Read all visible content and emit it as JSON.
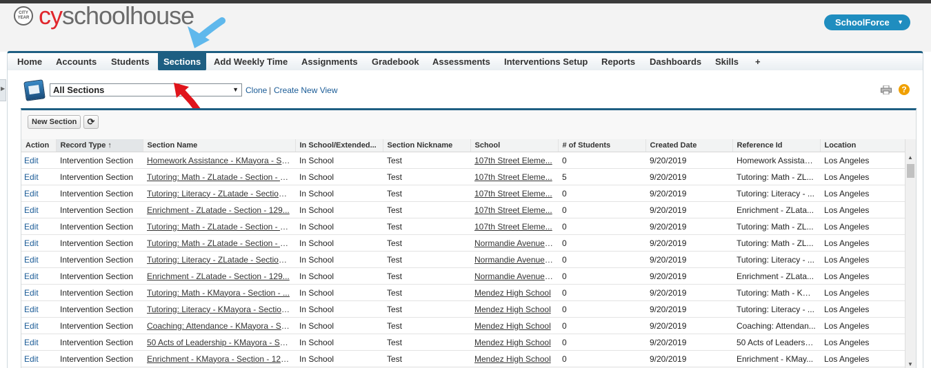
{
  "header": {
    "logo_seal": "CITY YEAR",
    "logo_prefix": "cy",
    "logo_rest": "schoolhouse",
    "app_menu_label": "SchoolForce",
    "app_menu_caret": "▼"
  },
  "tabs": [
    {
      "label": "Home"
    },
    {
      "label": "Accounts"
    },
    {
      "label": "Students"
    },
    {
      "label": "Sections",
      "active": true
    },
    {
      "label": "Add Weekly Time"
    },
    {
      "label": "Assignments"
    },
    {
      "label": "Gradebook"
    },
    {
      "label": "Assessments"
    },
    {
      "label": "Interventions Setup"
    },
    {
      "label": "Reports"
    },
    {
      "label": "Dashboards"
    },
    {
      "label": "Skills"
    },
    {
      "label": "+"
    }
  ],
  "view": {
    "selected": "All Sections",
    "clone_label": "Clone",
    "separator": "|",
    "create_label": "Create New View"
  },
  "toolbar": {
    "new_section_label": "New Section",
    "refresh_glyph": "⟳",
    "help_glyph": "?"
  },
  "table": {
    "columns": [
      "Action",
      "Record Type ↑",
      "Section Name",
      "In School/Extended...",
      "Section Nickname",
      "School",
      "# of Students",
      "Created Date",
      "Reference Id",
      "Location"
    ],
    "rows": [
      [
        "Edit",
        "Intervention Section",
        "Homework Assistance - KMayora - Se...",
        "In School",
        "Test",
        "107th Street Eleme...",
        "0",
        "9/20/2019",
        "Homework Assistan...",
        "Los Angeles"
      ],
      [
        "Edit",
        "Intervention Section",
        "Tutoring: Math - ZLatade - Section - 1...",
        "In School",
        "Test",
        "107th Street Eleme...",
        "5",
        "9/20/2019",
        "Tutoring: Math - ZL...",
        "Los Angeles"
      ],
      [
        "Edit",
        "Intervention Section",
        "Tutoring: Literacy - ZLatade - Section ...",
        "In School",
        "Test",
        "107th Street Eleme...",
        "0",
        "9/20/2019",
        "Tutoring: Literacy - ...",
        "Los Angeles"
      ],
      [
        "Edit",
        "Intervention Section",
        "Enrichment - ZLatade - Section - 129...",
        "In School",
        "Test",
        "107th Street Eleme...",
        "0",
        "9/20/2019",
        "Enrichment - ZLata...",
        "Los Angeles"
      ],
      [
        "Edit",
        "Intervention Section",
        "Tutoring: Math - ZLatade - Section - 1...",
        "In School",
        "Test",
        "107th Street Eleme...",
        "0",
        "9/20/2019",
        "Tutoring: Math - ZL...",
        "Los Angeles"
      ],
      [
        "Edit",
        "Intervention Section",
        "Tutoring: Math - ZLatade - Section - 1...",
        "In School",
        "Test",
        "Normandie Avenue ...",
        "0",
        "9/20/2019",
        "Tutoring: Math - ZL...",
        "Los Angeles"
      ],
      [
        "Edit",
        "Intervention Section",
        "Tutoring: Literacy - ZLatade - Section ...",
        "In School",
        "Test",
        "Normandie Avenue ...",
        "0",
        "9/20/2019",
        "Tutoring: Literacy - ...",
        "Los Angeles"
      ],
      [
        "Edit",
        "Intervention Section",
        "Enrichment - ZLatade - Section - 129...",
        "In School",
        "Test",
        "Normandie Avenue ...",
        "0",
        "9/20/2019",
        "Enrichment - ZLata...",
        "Los Angeles"
      ],
      [
        "Edit",
        "Intervention Section",
        "Tutoring: Math - KMayora - Section - ...",
        "In School",
        "Test",
        "Mendez High School",
        "0",
        "9/20/2019",
        "Tutoring: Math - KM...",
        "Los Angeles"
      ],
      [
        "Edit",
        "Intervention Section",
        "Tutoring: Literacy - KMayora - Section...",
        "In School",
        "Test",
        "Mendez High School",
        "0",
        "9/20/2019",
        "Tutoring: Literacy - ...",
        "Los Angeles"
      ],
      [
        "Edit",
        "Intervention Section",
        "Coaching: Attendance - KMayora - Se...",
        "In School",
        "Test",
        "Mendez High School",
        "0",
        "9/20/2019",
        "Coaching: Attendan...",
        "Los Angeles"
      ],
      [
        "Edit",
        "Intervention Section",
        "50 Acts of Leadership - KMayora - Se...",
        "In School",
        "Test",
        "Mendez High School",
        "0",
        "9/20/2019",
        "50 Acts of Leadersh...",
        "Los Angeles"
      ],
      [
        "Edit",
        "Intervention Section",
        "Enrichment - KMayora - Section - 129...",
        "In School",
        "Test",
        "Mendez High School",
        "0",
        "9/20/2019",
        "Enrichment - KMay...",
        "Los Angeles"
      ]
    ]
  },
  "colors": {
    "accent": "#1d5e82",
    "link": "#1a5b96",
    "logo_red": "#e0262c",
    "app_menu": "#1f8dbf",
    "annotation_blue": "#5fb8ec",
    "annotation_red": "#e0141b"
  }
}
